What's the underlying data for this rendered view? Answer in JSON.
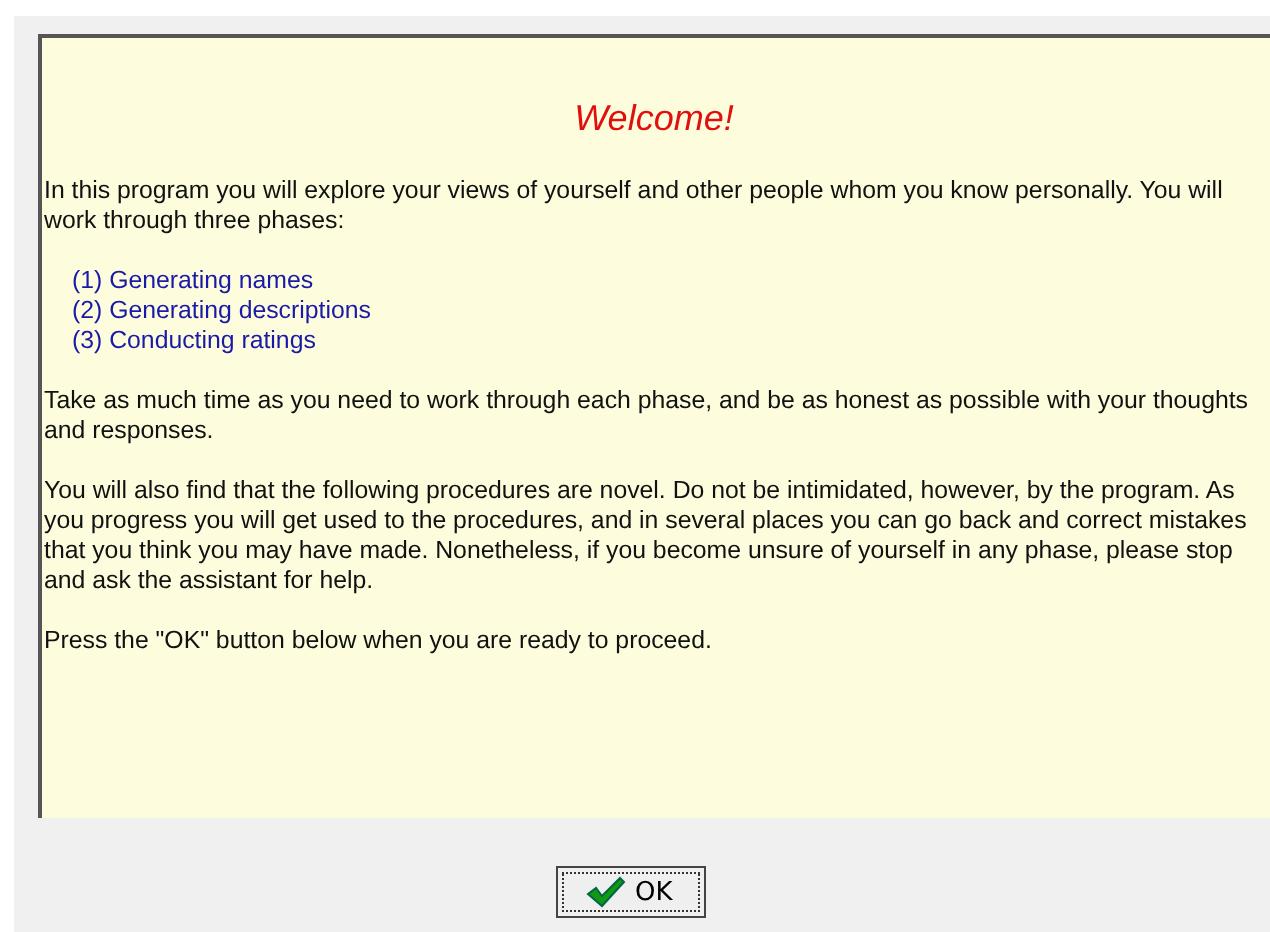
{
  "heading": "Welcome!",
  "intro": "In this program you will explore your views of yourself and other people whom you know personally. You will work through three phases:",
  "phases": [
    "(1) Generating names",
    "(2) Generating descriptions",
    "(3) Conducting ratings"
  ],
  "paragraphs": [
    "Take as much time as you need to work through each phase, and be as honest as possible with your thoughts and responses.",
    "You will also find that the following procedures are novel. Do not be intimidated, however, by the program. As you progress you will get used to the procedures, and in several places you can go back and correct mistakes that you think you may have made. Nonetheless, if you become unsure of yourself in any phase, please stop and ask the assistant for help.",
    "Press the \"OK\" button below when you are ready to proceed."
  ],
  "button": {
    "label": "OK"
  }
}
